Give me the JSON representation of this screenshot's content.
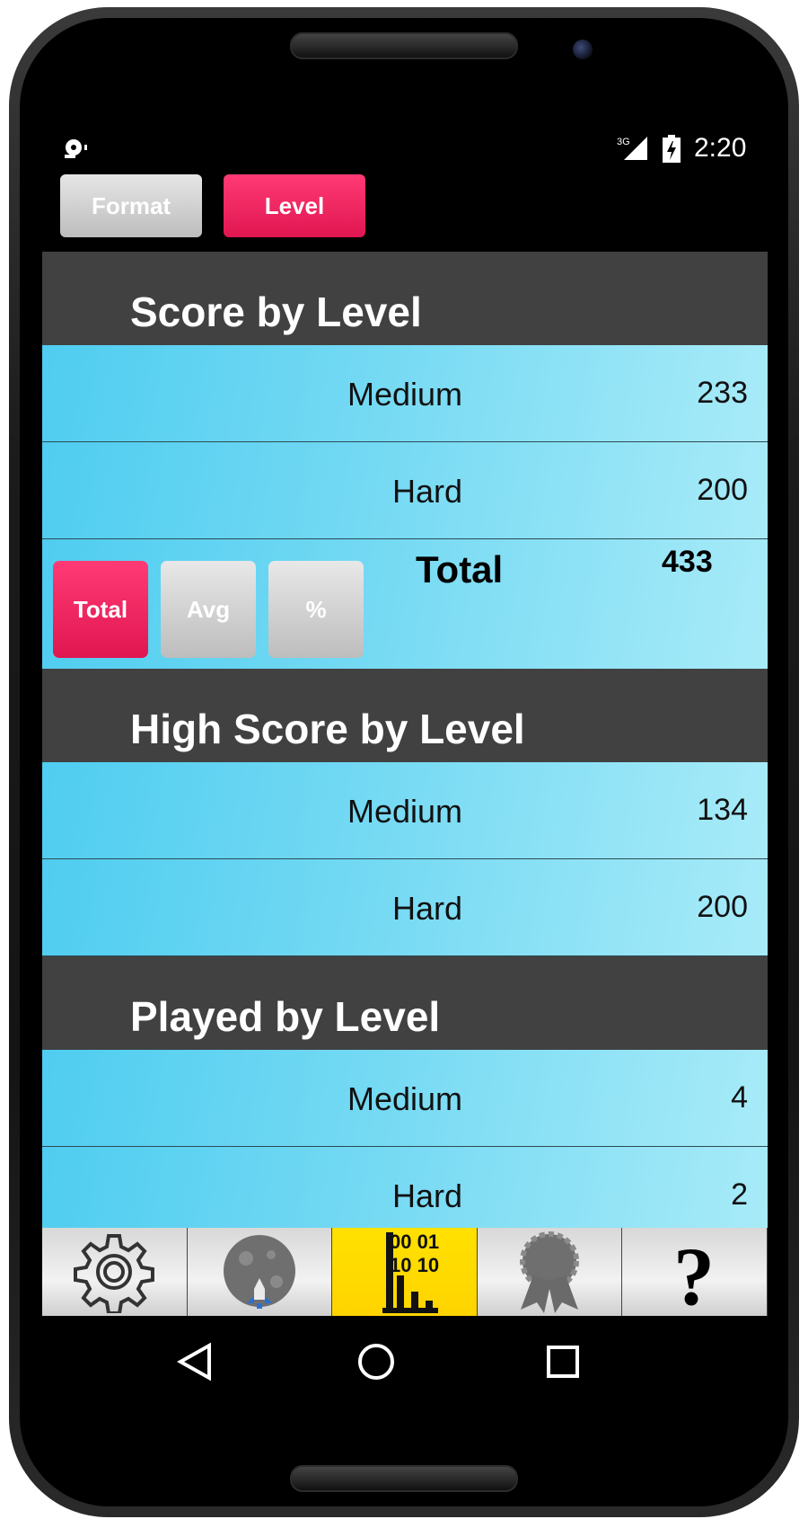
{
  "status": {
    "time": "2:20",
    "network": "3G"
  },
  "top_buttons": {
    "format": "Format",
    "level": "Level"
  },
  "sections": {
    "score": {
      "title": "Score by Level",
      "rows": [
        {
          "label": "Medium",
          "value": "233"
        },
        {
          "label": "Hard",
          "value": "200"
        }
      ],
      "total_label": "Total",
      "total_value": "433",
      "mode_buttons": {
        "total": "Total",
        "avg": "Avg",
        "percent": "%"
      }
    },
    "high_score": {
      "title": "High Score by Level",
      "rows": [
        {
          "label": "Medium",
          "value": "134"
        },
        {
          "label": "Hard",
          "value": "200"
        }
      ]
    },
    "played": {
      "title": "Played by Level",
      "rows": [
        {
          "label": "Medium",
          "value": "4"
        },
        {
          "label": "Hard",
          "value": "2"
        }
      ]
    }
  },
  "tabbar": {
    "items": [
      {
        "icon": "gear-icon"
      },
      {
        "icon": "moon-rocket-icon"
      },
      {
        "icon": "binary-chart-icon",
        "glyph_top": "00 01",
        "glyph_bottom": "10 10",
        "active": true
      },
      {
        "icon": "award-ribbon-icon"
      },
      {
        "icon": "question-icon",
        "glyph": "?"
      }
    ]
  },
  "colors": {
    "accent_pink": "#e01651",
    "active_tab": "#ffd400",
    "row_cyan": "#4fcdf0",
    "header_bg": "#414141"
  }
}
